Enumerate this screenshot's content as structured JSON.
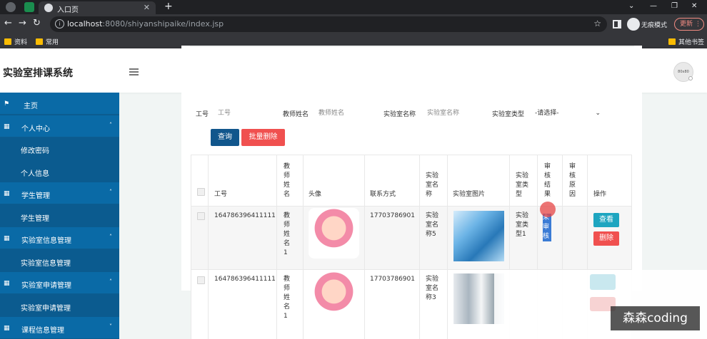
{
  "browser": {
    "tab_title": "入口页",
    "url_host": "localhost",
    "url_rest": ":8080/shiyanshipaike/index.jsp",
    "incognito_label": "无痕模式",
    "update_label": "更新",
    "bookmarks": [
      "资料",
      "常用"
    ],
    "other_bookmarks": "其他书签"
  },
  "header": {
    "title": "实验室排课系统",
    "avatar_text": "80x80"
  },
  "sidebar": {
    "items": [
      {
        "label": "主页",
        "kind": "top",
        "icon": "flag-icon"
      },
      {
        "label": "个人中心",
        "kind": "top",
        "icon": "grid-icon",
        "caret": "▲"
      },
      {
        "label": "修改密码",
        "kind": "sub"
      },
      {
        "label": "个人信息",
        "kind": "sub"
      },
      {
        "label": "学生管理",
        "kind": "top",
        "icon": "grid-icon",
        "caret": "▲"
      },
      {
        "label": "学生管理",
        "kind": "sub"
      },
      {
        "label": "实验室信息管理",
        "kind": "top",
        "icon": "grid-icon",
        "caret": "▲"
      },
      {
        "label": "实验室信息管理",
        "kind": "sub"
      },
      {
        "label": "实验室申请管理",
        "kind": "top",
        "icon": "grid-icon",
        "caret": "▲"
      },
      {
        "label": "实验室申请管理",
        "kind": "sub"
      },
      {
        "label": "课程信息管理",
        "kind": "top",
        "icon": "grid-icon",
        "caret": "▼"
      }
    ]
  },
  "filters": {
    "gonghao_label": "工号",
    "gonghao_placeholder": "工号",
    "teacher_label": "教师姓名",
    "teacher_placeholder": "教师姓名",
    "lab_name_label": "实验室名称",
    "lab_name_placeholder": "实验室名称",
    "lab_type_label": "实验室类型",
    "lab_type_value": "-请选择-",
    "query_button": "查询",
    "batch_delete_button": "批量删除"
  },
  "table": {
    "headers": [
      "工号",
      "教师姓名",
      "头像",
      "联系方式",
      "实验室名称",
      "实验室图片",
      "实验室类型",
      "审核结果",
      "审核原因",
      "操作"
    ],
    "rows": [
      {
        "gonghao": "164786396411111",
        "teacher": "教师姓名1",
        "phone": "17703786901",
        "lab_name": "实验室名称5",
        "lab_type": "实验室类型1",
        "audit_result": "未审核",
        "audit_reason": "",
        "view": "查看",
        "delete": "删除"
      },
      {
        "gonghao": "164786396411111",
        "teacher": "教师姓名1",
        "phone": "17703786901",
        "lab_name": "实验室名称3",
        "lab_type": "",
        "audit_result": "",
        "audit_reason": "",
        "view": "",
        "delete": ""
      }
    ]
  },
  "watermark": "森森coding",
  "colors": {
    "sidebar": "#0b5b8f",
    "query_button": "#11568c",
    "delete_button": "#f0504f",
    "view_button": "#1ea5c0"
  }
}
